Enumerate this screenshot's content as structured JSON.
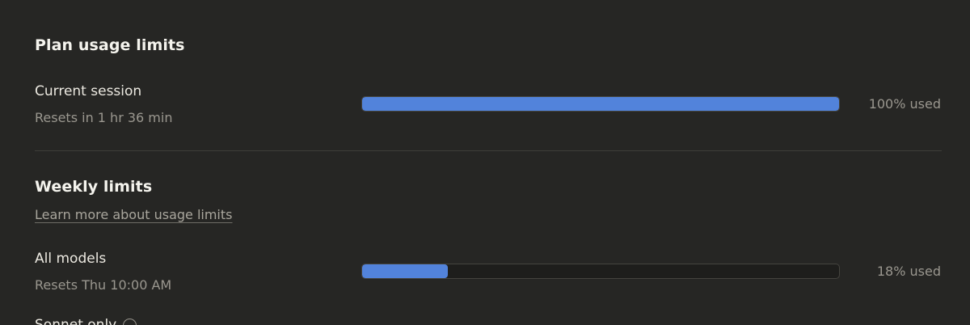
{
  "plan": {
    "title": "Plan usage limits",
    "session": {
      "label": "Current session",
      "reset": "Resets in 1 hr 36 min",
      "used_fraction": 1.0,
      "used_text": "100% used"
    }
  },
  "weekly": {
    "title": "Weekly limits",
    "learn_more": "Learn more about usage limits",
    "all_models": {
      "label": "All models",
      "reset": "Resets Thu 10:00 AM",
      "used_fraction": 0.18,
      "used_text": "18% used"
    },
    "next_row": {
      "label": "Sonnet only"
    }
  },
  "colors": {
    "background": "#262624",
    "bar_fill": "#5283db",
    "bar_track": "#1e1e1c"
  },
  "icons": {
    "info": "info-icon"
  }
}
